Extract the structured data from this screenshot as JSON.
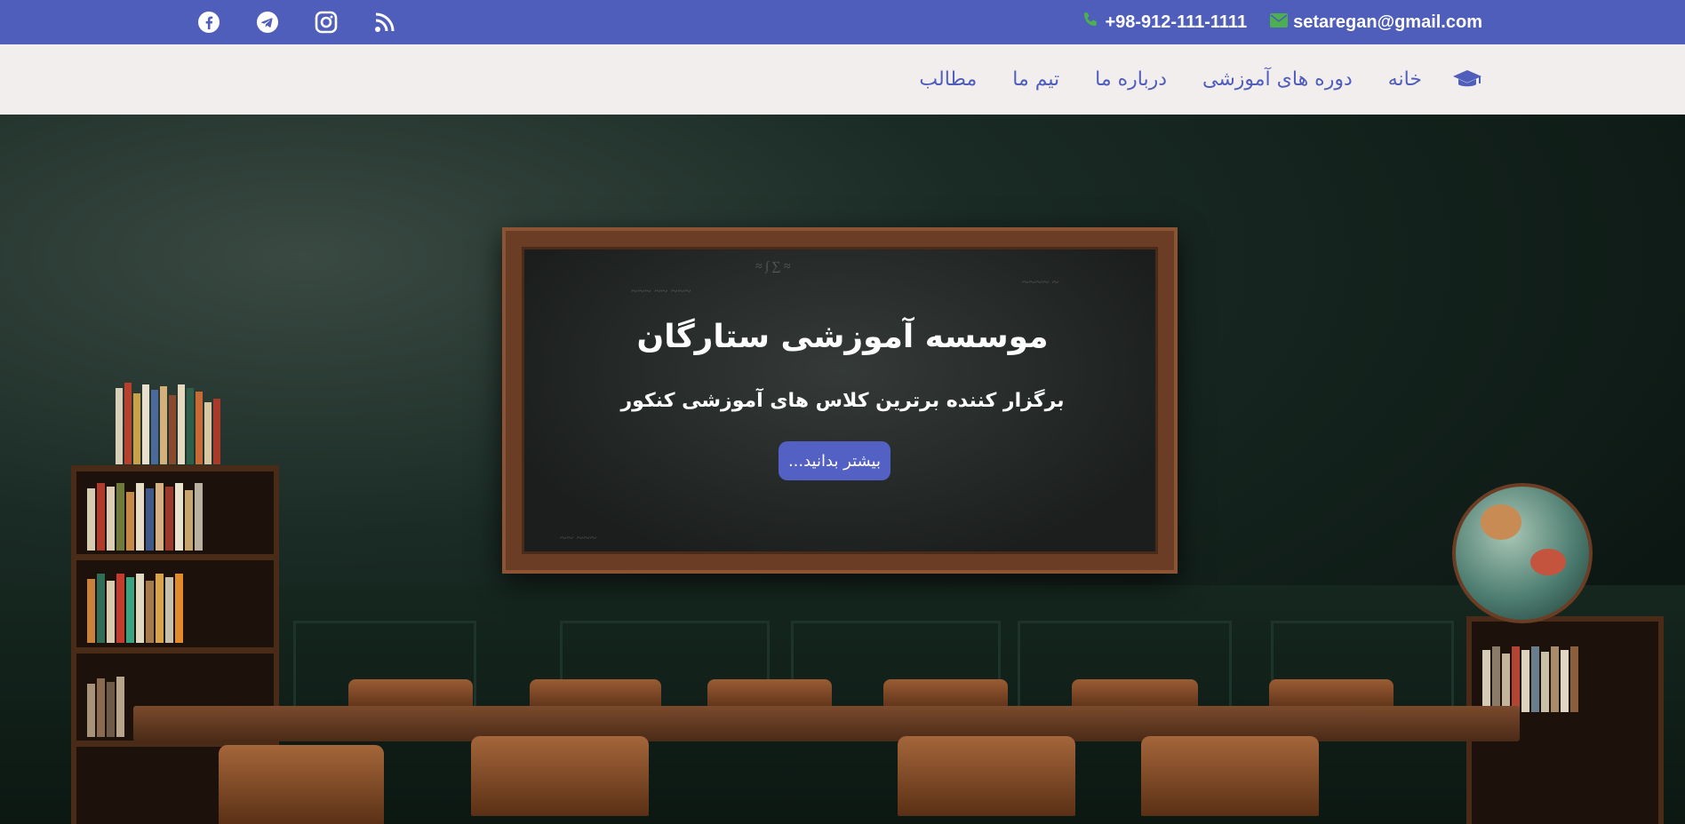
{
  "topbar": {
    "email": "setaregan@gmail.com",
    "phone": "+98-912-111-1111",
    "social_icons": [
      "facebook-icon",
      "telegram-icon",
      "instagram-icon",
      "rss-icon"
    ]
  },
  "colors": {
    "brand": "#4f5dbb",
    "navbar_bg": "#f3eeee",
    "contact_icon": "#4caf50",
    "button_bg": "#5360c4"
  },
  "nav": {
    "logo_icon": "graduation-cap-icon",
    "items": [
      "خانه",
      "دوره های آموزشی",
      "درباره ما",
      "تیم ما",
      "مطالب"
    ]
  },
  "hero": {
    "title": "موسسه آموزشی ستارگان",
    "subtitle": "برگزار کننده برترین کلاس های آموزشی کنکور",
    "button_label": "بیشتر بدانید..."
  }
}
